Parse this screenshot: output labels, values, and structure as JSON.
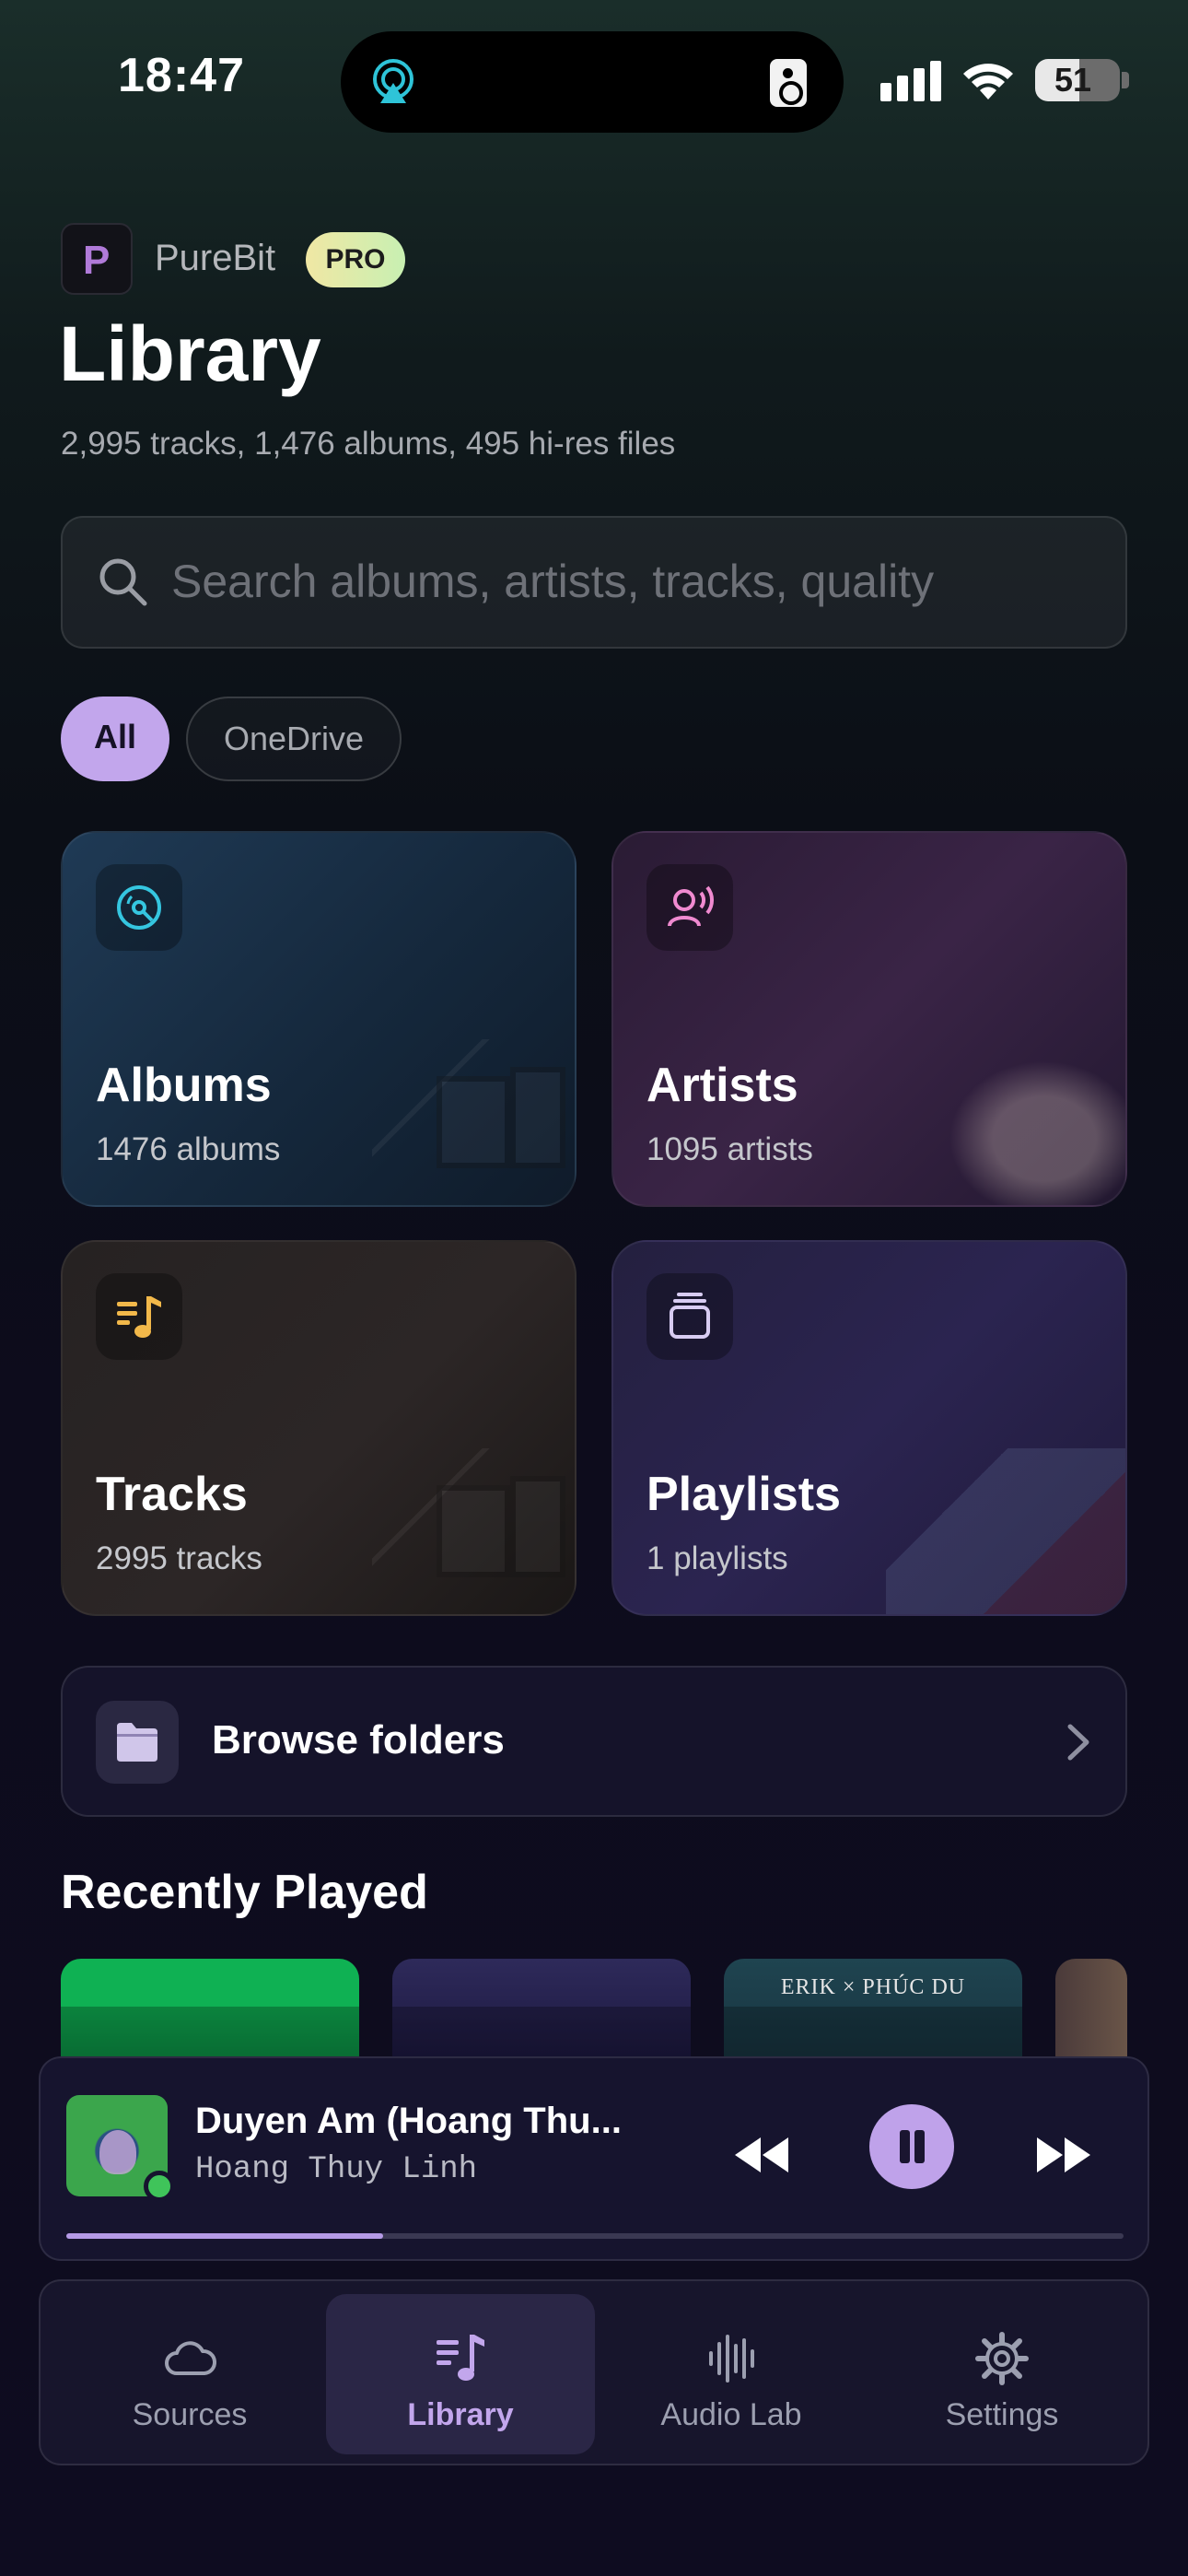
{
  "status_bar": {
    "time": "18:47",
    "battery": "51",
    "icons": [
      "airplay-icon",
      "speaker-icon",
      "cellular-signal-icon",
      "wifi-icon",
      "battery-icon"
    ]
  },
  "header": {
    "app_name": "PureBit",
    "logo_letter": "P",
    "badge": "PRO",
    "title": "Library",
    "subtitle": "2,995 tracks, 1,476 albums, 495 hi-res files"
  },
  "search": {
    "placeholder": "Search albums, artists, tracks, quality",
    "value": ""
  },
  "filters": [
    {
      "label": "All",
      "selected": true
    },
    {
      "label": "OneDrive",
      "selected": false
    }
  ],
  "cards": [
    {
      "title": "Albums",
      "subtitle": "1476 albums",
      "icon": "vinyl-icon",
      "accent": "#35c6e0"
    },
    {
      "title": "Artists",
      "subtitle": "1095 artists",
      "icon": "artist-voice-icon",
      "accent": "#f08ad0"
    },
    {
      "title": "Tracks",
      "subtitle": "2995 tracks",
      "icon": "music-note-list-icon",
      "accent": "#f2b84a"
    },
    {
      "title": "Playlists",
      "subtitle": "1 playlists",
      "icon": "stack-icon",
      "accent": "#d8ccf2"
    }
  ],
  "browse": {
    "label": "Browse folders",
    "icon": "folder-icon"
  },
  "recently_played": {
    "title": "Recently Played",
    "items": [
      {
        "art_text": ""
      },
      {
        "art_text": ""
      },
      {
        "art_text": "ERIK × PHÚC DU"
      },
      {
        "art_text": ""
      }
    ]
  },
  "now_playing": {
    "title": "Duyen Am (Hoang Thu...",
    "artist": "Hoang Thuy Linh",
    "progress": 0.3,
    "state": "playing"
  },
  "tabs": [
    {
      "label": "Sources",
      "icon": "cloud-icon",
      "active": false
    },
    {
      "label": "Library",
      "icon": "music-library-icon",
      "active": true
    },
    {
      "label": "Audio Lab",
      "icon": "waveform-icon",
      "active": false
    },
    {
      "label": "Settings",
      "icon": "gear-icon",
      "active": false
    }
  ],
  "colors": {
    "accent": "#c2a6ec",
    "background": "#0d0c1c",
    "pro_badge": "#d8eeae"
  }
}
